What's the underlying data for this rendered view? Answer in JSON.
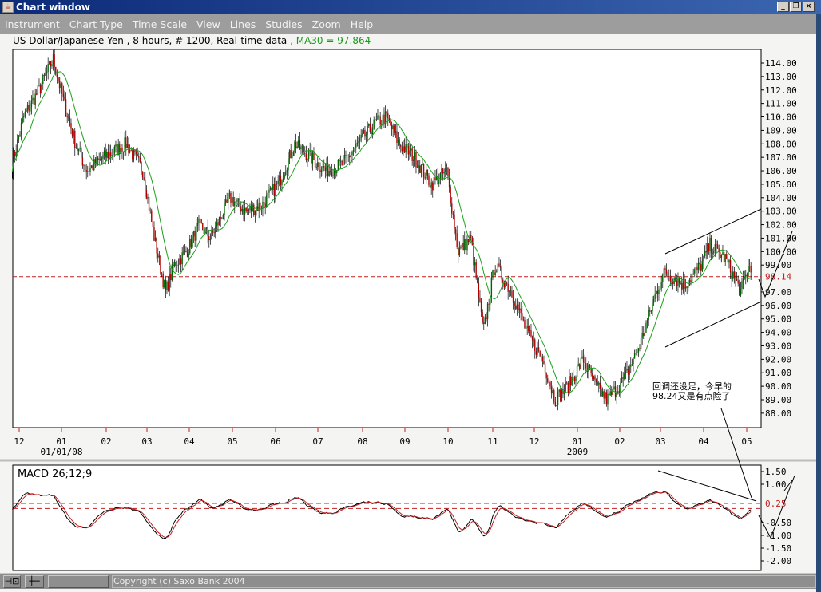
{
  "window": {
    "title": "Chart window",
    "controls": [
      "minimize",
      "restore",
      "close"
    ]
  },
  "menu": [
    "Instrument",
    "Chart Type",
    "Time Scale",
    "View",
    "Lines",
    "Studies",
    "Zoom",
    "Help"
  ],
  "info": {
    "instrument": "US Dollar/Japanese Yen , 8 hours, # 1200, Real-time data",
    "ma": " , MA30 = 97.864"
  },
  "colors": {
    "up": "#006400",
    "down": "#b00000",
    "ma": "#1aa01a",
    "ref": "#c02020"
  },
  "chart_data": [
    {
      "type": "candlestick",
      "y_ticks": [
        "114.00",
        "113.00",
        "112.00",
        "111.00",
        "110.00",
        "109.00",
        "108.00",
        "107.00",
        "106.00",
        "105.00",
        "104.00",
        "103.00",
        "102.00",
        "101.00",
        "100.00",
        "99.00",
        "97.00",
        "96.00",
        "95.00",
        "94.00",
        "93.00",
        "92.00",
        "91.00",
        "90.00",
        "89.00",
        "88.00"
      ],
      "ylim": [
        87.5,
        114.9
      ],
      "ref_line": {
        "value": 98.14,
        "label": "98.14"
      },
      "x_ticks": [
        "12",
        "01",
        "02",
        "03",
        "04",
        "05",
        "06",
        "07",
        "08",
        "09",
        "10",
        "11",
        "12",
        "01",
        "02",
        "03",
        "04",
        "05"
      ],
      "x_sublabels": {
        "jan08": "01/01/08",
        "jan09": "2009"
      },
      "series_price": [
        [
          "2007-11-27",
          106.5
        ],
        [
          "2007-12-05",
          110
        ],
        [
          "2007-12-16",
          112
        ],
        [
          "2007-12-26",
          114.3
        ],
        [
          "2008-01-03",
          111
        ],
        [
          "2008-01-11",
          108
        ],
        [
          "2008-01-19",
          106
        ],
        [
          "2008-01-31",
          107
        ],
        [
          "2008-02-16",
          108
        ],
        [
          "2008-02-28",
          106
        ],
        [
          "2008-03-07",
          101
        ],
        [
          "2008-03-15",
          97
        ],
        [
          "2008-03-21",
          99
        ],
        [
          "2008-03-30",
          100
        ],
        [
          "2008-04-08",
          102
        ],
        [
          "2008-04-16",
          101
        ],
        [
          "2008-04-30",
          104
        ],
        [
          "2008-05-11",
          103
        ],
        [
          "2008-05-23",
          103.5
        ],
        [
          "2008-06-03",
          105
        ],
        [
          "2008-06-15",
          108
        ],
        [
          "2008-06-26",
          107
        ],
        [
          "2008-07-07",
          106
        ],
        [
          "2008-07-19",
          106.5
        ],
        [
          "2008-07-30",
          108
        ],
        [
          "2008-08-11",
          109.5
        ],
        [
          "2008-08-19",
          110
        ],
        [
          "2008-08-28",
          108
        ],
        [
          "2008-09-08",
          107
        ],
        [
          "2008-09-20",
          105
        ],
        [
          "2008-10-01",
          106
        ],
        [
          "2008-10-09",
          100
        ],
        [
          "2008-10-18",
          101
        ],
        [
          "2008-10-27",
          94
        ],
        [
          "2008-11-04",
          99
        ],
        [
          "2008-11-16",
          97
        ],
        [
          "2008-11-27",
          94
        ],
        [
          "2008-12-08",
          92
        ],
        [
          "2008-12-17",
          89
        ],
        [
          "2008-12-26",
          90
        ],
        [
          "2009-01-06",
          92
        ],
        [
          "2009-01-15",
          90
        ],
        [
          "2009-01-23",
          89
        ],
        [
          "2009-02-04",
          90.5
        ],
        [
          "2009-02-15",
          93
        ],
        [
          "2009-02-27",
          97
        ],
        [
          "2009-03-05",
          98.5
        ],
        [
          "2009-03-19",
          97.5
        ],
        [
          "2009-03-31",
          99
        ],
        [
          "2009-04-06",
          100.5
        ],
        [
          "2009-04-17",
          99.5
        ],
        [
          "2009-04-28",
          97
        ],
        [
          "2009-05-04",
          99
        ],
        [
          "2009-05-06",
          98.2
        ]
      ],
      "ma_label": "MA30",
      "annotation": "回调还没足，今早的\n98.24又是有点险了"
    },
    {
      "type": "line",
      "title": "MACD 26;12;9",
      "y_ticks": [
        "1.50",
        "1.00",
        "-0.50",
        "-1.00",
        "-1.50",
        "-2.00"
      ],
      "ylim": [
        -2.3,
        1.75
      ],
      "ref_lines": [
        {
          "value": 0.25,
          "label": "0.25"
        },
        {
          "value": 0.05,
          "label": ""
        }
      ]
    }
  ],
  "status": {
    "copyright": "Copyright (c) Saxo Bank 2004",
    "btn1": "⊣⊡",
    "btn2": "┼─"
  }
}
